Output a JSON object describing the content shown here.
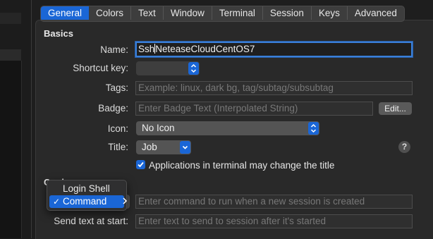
{
  "tabs": [
    {
      "label": "General",
      "active": true
    },
    {
      "label": "Colors"
    },
    {
      "label": "Text"
    },
    {
      "label": "Window"
    },
    {
      "label": "Terminal"
    },
    {
      "label": "Session"
    },
    {
      "label": "Keys"
    },
    {
      "label": "Advanced"
    }
  ],
  "basics": {
    "title": "Basics",
    "name_label": "Name:",
    "name_value_before": "Ssh",
    "name_value_after": "NeteaseCloudCentOS7",
    "shortcut_label": "Shortcut key:",
    "tags_label": "Tags:",
    "tags_placeholder": "Example: linux, dark bg, tag/subtag/subsubtag",
    "badge_label": "Badge:",
    "badge_placeholder": "Enter Badge Text (Interpolated String)",
    "edit_button": "Edit...",
    "icon_label": "Icon:",
    "icon_value": "No Icon",
    "title_label": "Title:",
    "title_value": "Job",
    "help_button": "?",
    "title_change_checkbox": "Applications in terminal may change the title",
    "title_change_checked": true
  },
  "command": {
    "section_title_partial": "Co          d",
    "menu_options": [
      "Login Shell",
      "Command"
    ],
    "menu_selected": "Command",
    "checkmark": "✓",
    "command_placeholder": "Enter command to run when a new session is created",
    "send_text_label": "Send text at start:",
    "send_text_placeholder": "Enter text to send to session after it's started"
  },
  "colors": {
    "accent": "#1a66d6",
    "panel": "#292929",
    "background": "#1e1e1e"
  }
}
